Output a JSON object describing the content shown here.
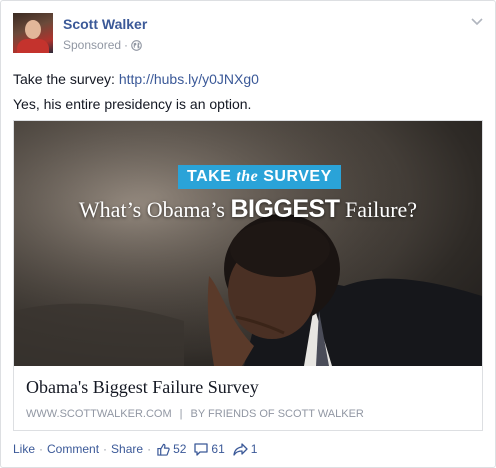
{
  "post": {
    "author": "Scott Walker",
    "sponsored_label": "Sponsored",
    "meta_separator": "·",
    "privacy_icon": "globe-icon",
    "menu_icon": "chevron-down-icon",
    "text_prefix": "Take the survey: ",
    "text_link": "http://hubs.ly/y0JNXg0",
    "text_line2": "Yes, his entire presidency is an option."
  },
  "link_preview": {
    "image_badge_prefix": "TAKE",
    "image_badge_em": "the",
    "image_badge_suffix": "SURVEY",
    "image_headline_pre": "What’s Obama’s ",
    "image_headline_bold": "BIGGEST",
    "image_headline_post": " Failure?",
    "title": "Obama's Biggest Failure Survey",
    "domain": "WWW.SCOTTWALKER.COM",
    "caption_separator": "|",
    "byline": "BY FRIENDS OF SCOTT WALKER"
  },
  "actions": {
    "like": "Like",
    "comment": "Comment",
    "share": "Share",
    "separator": "·",
    "likes_count": "52",
    "comments_count": "61",
    "shares_count": "1"
  },
  "colors": {
    "link": "#3b5998",
    "meta": "#9197a3",
    "badge": "#2aa3d8"
  }
}
